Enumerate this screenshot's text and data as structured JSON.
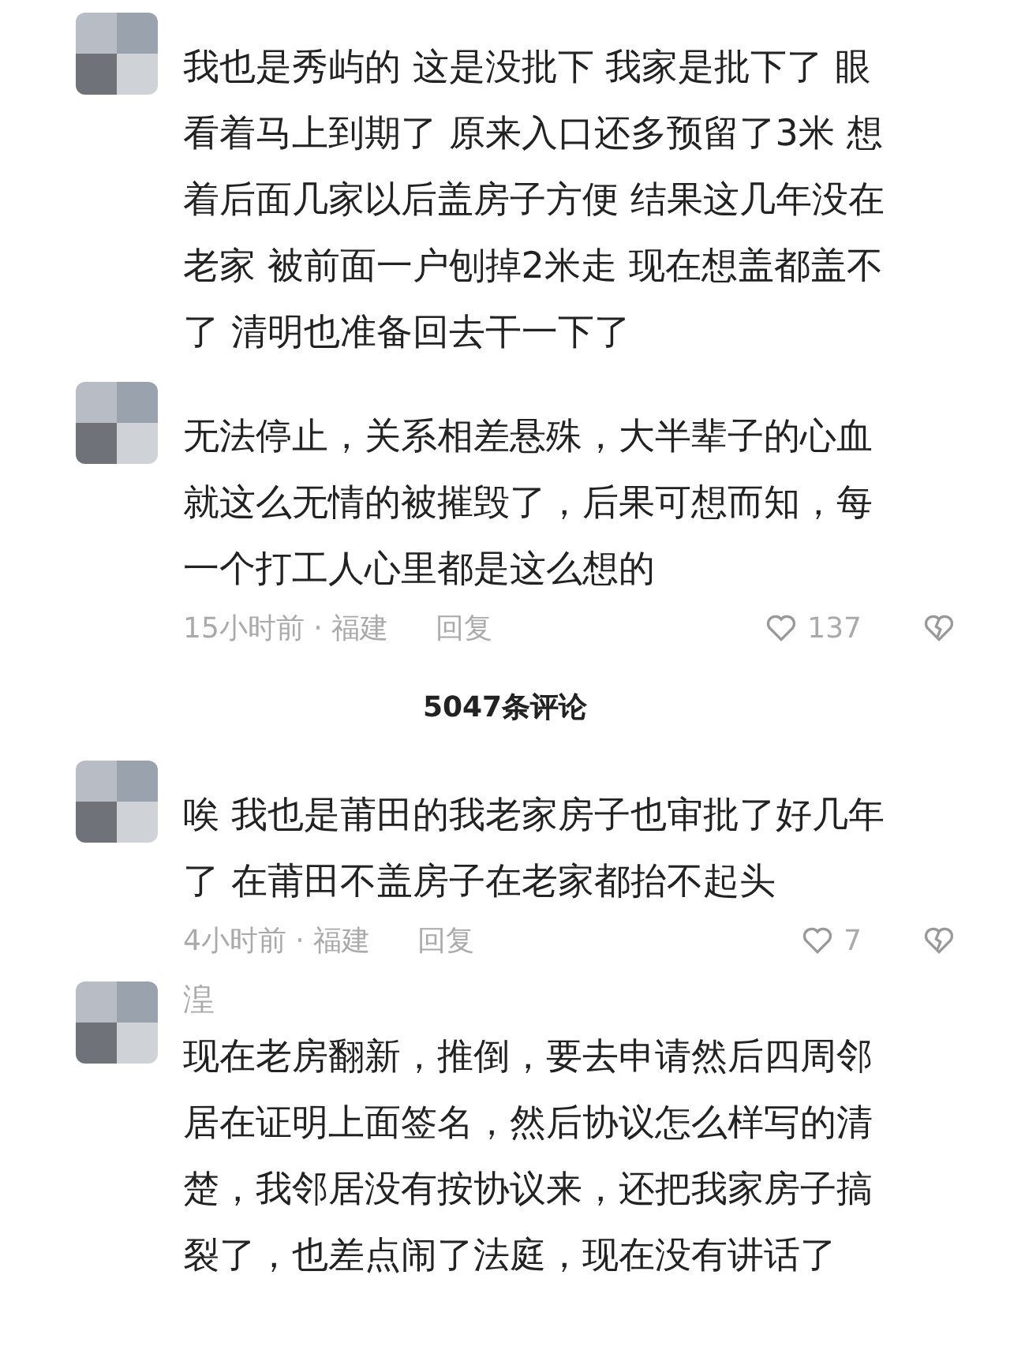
{
  "comments_top": [
    {
      "text": "我也是秀屿的 这是没批下 我家是批下了 眼看着马上到期了 原来入口还多预留了3米 想着后面几家以后盖房子方便 结果这几年没在老家 被前面一户刨掉2米走 现在想盖都盖不了 清明也准备回去干一下了"
    },
    {
      "text": "无法停止，关系相差悬殊，大半辈子的心血就这么无情的被摧毁了，后果可想而知，每一个打工人心里都是这么想的",
      "meta": {
        "time": "15小时前 · 福建",
        "reply": "回复",
        "likes": "137"
      }
    }
  ],
  "comment_count": "5047条评论",
  "comments_bottom": [
    {
      "text": "唉 我也是莆田的我老家房子也审批了好几年了 在莆田不盖房子在老家都抬不起头",
      "meta": {
        "time": "4小时前 · 福建",
        "reply": "回复",
        "likes": "7"
      }
    },
    {
      "username": "湟",
      "text": "现在老房翻新，推倒，要去申请然后四周邻居在证明上面签名，然后协议怎么样写的清楚，我邻居没有按协议来，还把我家房子搞裂了，也差点闹了法庭，现在没有讲话了"
    }
  ]
}
